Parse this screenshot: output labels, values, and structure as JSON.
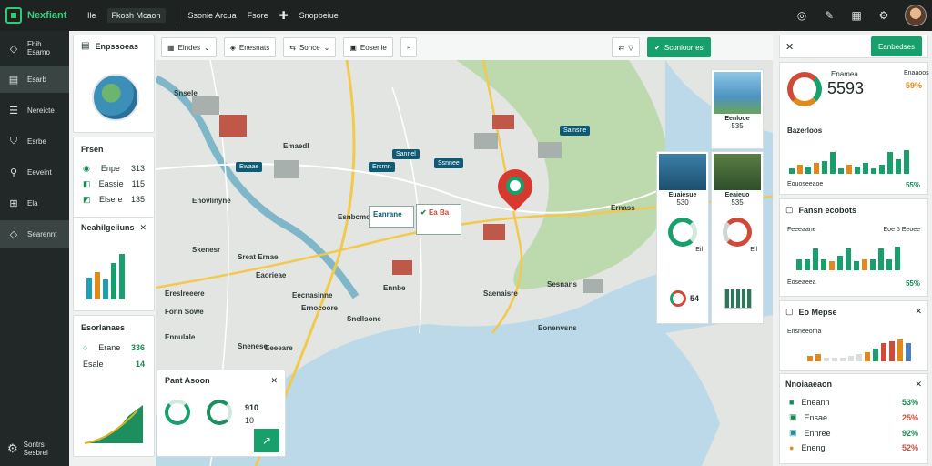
{
  "app": {
    "name": "Nexfiant"
  },
  "topnav": {
    "item1": "Ile",
    "item2": "Fkosh Mcaon",
    "item3": "Ssonie Arcua",
    "item4": "Fsore",
    "item5": "Snopbeiue"
  },
  "sidebar": {
    "items": [
      {
        "label": "Fbih\nEsamo",
        "icon": "diamond-icon"
      },
      {
        "label": "Esarb",
        "icon": "chart-icon"
      },
      {
        "label": "Nereicte",
        "icon": "inbox-icon"
      },
      {
        "label": "Esrbe",
        "icon": "shield-icon"
      },
      {
        "label": "Eeveint",
        "icon": "pin-icon"
      },
      {
        "label": "Ela",
        "icon": "grid-icon"
      },
      {
        "label": "Searennt",
        "icon": "layers-icon"
      }
    ],
    "bottom": "Sontrs\nSesbrel"
  },
  "left": {
    "card1_title": "Enpssoeas",
    "card2_title": "Frsen",
    "card2_rows": [
      {
        "k": "Enpe",
        "v": "313"
      },
      {
        "k": "Eassie",
        "v": "115"
      },
      {
        "k": "Elsere",
        "v": "135"
      }
    ],
    "card3_title": "Neahilgeiiuns",
    "card4_title": "Esorlanaes",
    "card4_rows": [
      {
        "k": "Erane",
        "v": "336"
      },
      {
        "k": "Esale",
        "v": "14"
      }
    ]
  },
  "toolbar": {
    "filter": "Elndes",
    "places": "Enesnats",
    "sence": "Sonce",
    "remove": "Eosenie",
    "share": "Sconloorres"
  },
  "map": {
    "labels": [
      "Snsele",
      "Emaedl",
      "Esnbcmot",
      "Enovlinyne",
      "Skenesr",
      "Sreat Ernae",
      "Eaorieae",
      "Ereslreeere",
      "Eecnasinne",
      "Fonn Sowe",
      "Ennulale",
      "Ernocoore",
      "Snellsone",
      "Snenese",
      "Ennbe",
      "Saenaisre",
      "Sesnans",
      "Ernass",
      "Eonenvsns",
      "Eeeeare"
    ],
    "tags": [
      "Salnsne",
      "Sannel",
      "Ssnnee",
      "Ersrnn",
      "Ewaae"
    ],
    "popup_left": "Eanrane",
    "popup_right": "Ea Ba",
    "card_a_title": "Eenlooe",
    "card_a_value": "535",
    "card_b_title": "Euaiesue",
    "card_b_value": "530",
    "card_c_title": "Eeaieuo",
    "card_c_value": "535",
    "donut1_label": "Eil",
    "donut2_label": "Eil",
    "mini_val": "Eil",
    "small_donut_val": "54"
  },
  "bottom_card": {
    "title": "Pant Asoon",
    "v1": "910",
    "v2": "10"
  },
  "right": {
    "btn": "Eanbedses",
    "c1_title": "Enamea",
    "c1_value": "5593",
    "c1_pct": "59%",
    "c1_sub": "Enaaoos",
    "c1_sub2": "Bazerloos",
    "c1_foot_label": "Eouoseeaoe",
    "c1_foot_pct": "55%",
    "c2_title": "Fansn ecobots",
    "c2_sub": "Feeeaane",
    "c2_sub2": "Eoe 5 Eeoee",
    "c2_foot_label": "Eoseaeea",
    "c2_foot_pct": "55%",
    "c3_title": "Eo Mepse",
    "c3_sub": "Ensneeoma",
    "c4_title": "Nnoiaaeaon",
    "c4_rows": [
      {
        "k": "Eneann",
        "v": "53%",
        "c": "g"
      },
      {
        "k": "Ensae",
        "v": "25%",
        "c": "r"
      },
      {
        "k": "Ennree",
        "v": "92%",
        "c": "g"
      },
      {
        "k": "Eneng",
        "v": "52%",
        "c": "r"
      }
    ]
  },
  "colors": {
    "accent": "#17a06c",
    "dark": "#1e2322",
    "orange": "#e08a1e",
    "red": "#d04a3a"
  }
}
